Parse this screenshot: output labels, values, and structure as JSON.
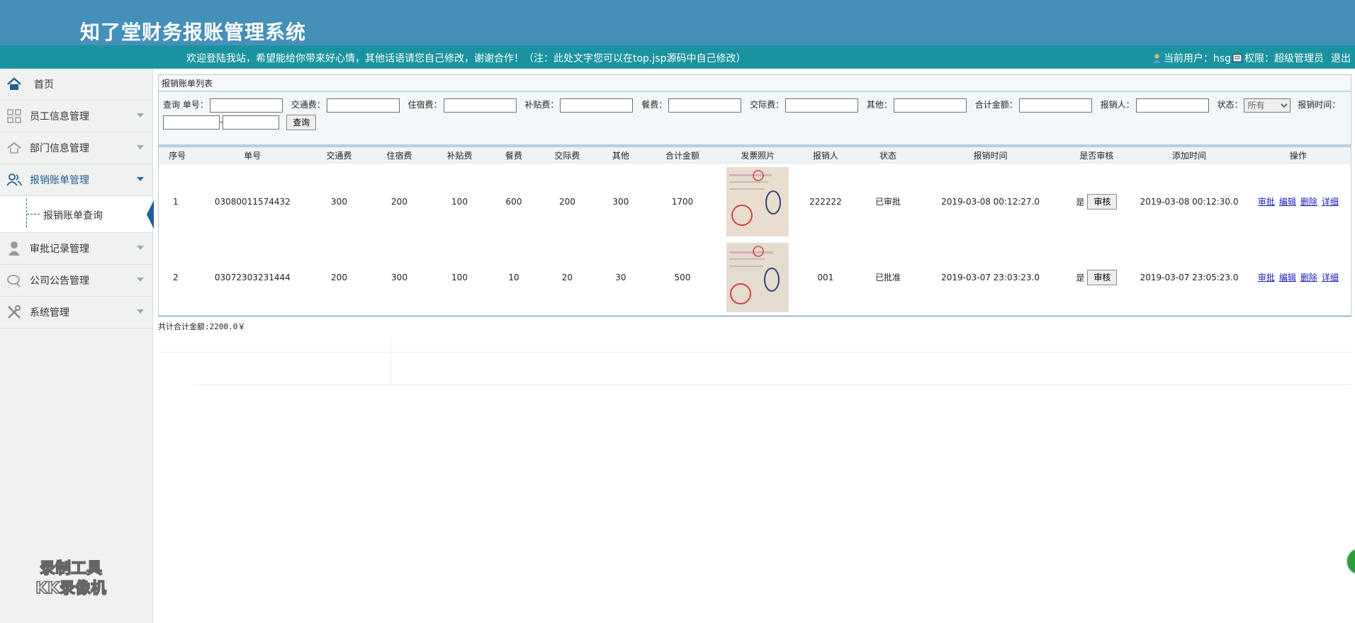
{
  "header": {
    "app_title": "知了堂财务报账管理系统",
    "welcome": "欢迎登陆我站，希望能给你带来好心情，其他话语请您自己修改，谢谢合作！（注：此处文字您可以在top.jsp源码中自己修改）",
    "user_label": "当前用户：hsg",
    "role_label": "权限：超级管理员",
    "logout": "退出"
  },
  "sidebar": {
    "items": [
      {
        "label": "首页"
      },
      {
        "label": "员工信息管理"
      },
      {
        "label": "部门信息管理"
      },
      {
        "label": "报销账单管理"
      },
      {
        "label": "审批记录管理"
      },
      {
        "label": "公司公告管理"
      },
      {
        "label": "系统管理"
      }
    ],
    "sub_item": "报销账单查询",
    "watermark_line1": "录制工具",
    "watermark_line2": "KK录像机"
  },
  "panel": {
    "title": "报销账单列表",
    "query_label": "查询",
    "fields": {
      "order_no": "单号：",
      "traffic": "交通费：",
      "lodging": "住宿费：",
      "subsidy": "补贴费：",
      "meal": "餐费：",
      "social": "交际费：",
      "other": "其他：",
      "total": "合计金额：",
      "applicant": "报销人：",
      "status": "状态：",
      "time": "报销时间："
    },
    "status_selected": "所有",
    "date_separator": "-",
    "search_button": "查询"
  },
  "table": {
    "headers": [
      "序号",
      "单号",
      "交通费",
      "住宿费",
      "补贴费",
      "餐费",
      "交际费",
      "其他",
      "合计金额",
      "发票照片",
      "报销人",
      "状态",
      "报销时间",
      "是否审核",
      "添加时间",
      "操作"
    ],
    "rows": [
      {
        "seq": "1",
        "no": "03080011574432",
        "traffic": "300",
        "lodging": "200",
        "subsidy": "100",
        "meal": "600",
        "social": "200",
        "other": "300",
        "total": "1700",
        "applicant": "222222",
        "status": "已审批",
        "time": "2019-03-08 00:12:27.0",
        "audited": "是",
        "added": "2019-03-08 00:12:30.0"
      },
      {
        "seq": "2",
        "no": "03072303231444",
        "traffic": "200",
        "lodging": "300",
        "subsidy": "100",
        "meal": "10",
        "social": "20",
        "other": "30",
        "total": "500",
        "applicant": "001",
        "status": "已批准",
        "time": "2019-03-07 23:03:23.0",
        "audited": "是",
        "added": "2019-03-07 23:05:23.0"
      }
    ],
    "audit_button": "审核",
    "ops": [
      "审批",
      "编辑",
      "删除",
      "详细"
    ]
  },
  "summary": "共计合计金额:2200.0￥",
  "colors": {
    "header": "#4490b9",
    "topbar": "#1a93a0",
    "sidebar": "#f0f1f1",
    "accent": "#1f5f92"
  }
}
